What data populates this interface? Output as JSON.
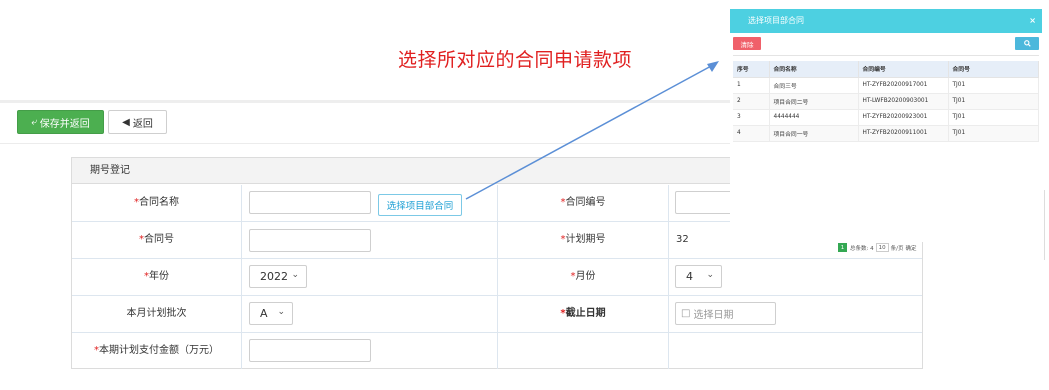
{
  "annotation": "选择所对应的合同申请款项",
  "toolbar": {
    "save_return_label": "保存并返回",
    "back_label": "返回"
  },
  "panel": {
    "title": "期号登记"
  },
  "form": {
    "contract_name_label": "合同名称",
    "contract_name_value": "",
    "pick_contract_label": "选择项目部合同",
    "contract_code_label": "合同编号",
    "contract_code_value": "",
    "contract_no_label": "合同号",
    "contract_no_value": "",
    "plan_period_label": "计划期号",
    "plan_period_value": "32",
    "year_label": "年份",
    "year_value": "2022",
    "month_label": "月份",
    "month_value": "4",
    "batch_label": "本月计划批次",
    "batch_value": "A",
    "deadline_label": "截止日期",
    "deadline_placeholder": "选择日期",
    "amount_label": "本期计划支付金额（万元）",
    "amount_value": "",
    "required_mark": "*"
  },
  "popup": {
    "title": "选择项目部合同",
    "close": "×",
    "clear_label": "清除",
    "search_icon": "search-icon",
    "columns": [
      "序号",
      "合同名称",
      "合同编号",
      "合同号"
    ],
    "rows": [
      [
        "1",
        "合同三号",
        "HT-ZYFB20200917001",
        "TJ01"
      ],
      [
        "2",
        "项目合同二号",
        "HT-LWFB20200903001",
        "TJ01"
      ],
      [
        "3",
        "4444444",
        "HT-ZYFB20200923001",
        "TJ01"
      ],
      [
        "4",
        "项目合同一号",
        "HT-ZYFB20200911001",
        "TJ01"
      ]
    ],
    "pager": {
      "current_page": "1",
      "total_label": "总条数: 4",
      "page_size": "10",
      "per_page_label": "条/页",
      "confirm_label": "确定"
    }
  },
  "colors": {
    "save_green": "#4caf50",
    "popup_header": "#4dd0e1",
    "required_red": "#e02020",
    "arrow_blue": "#5b8fd6"
  }
}
